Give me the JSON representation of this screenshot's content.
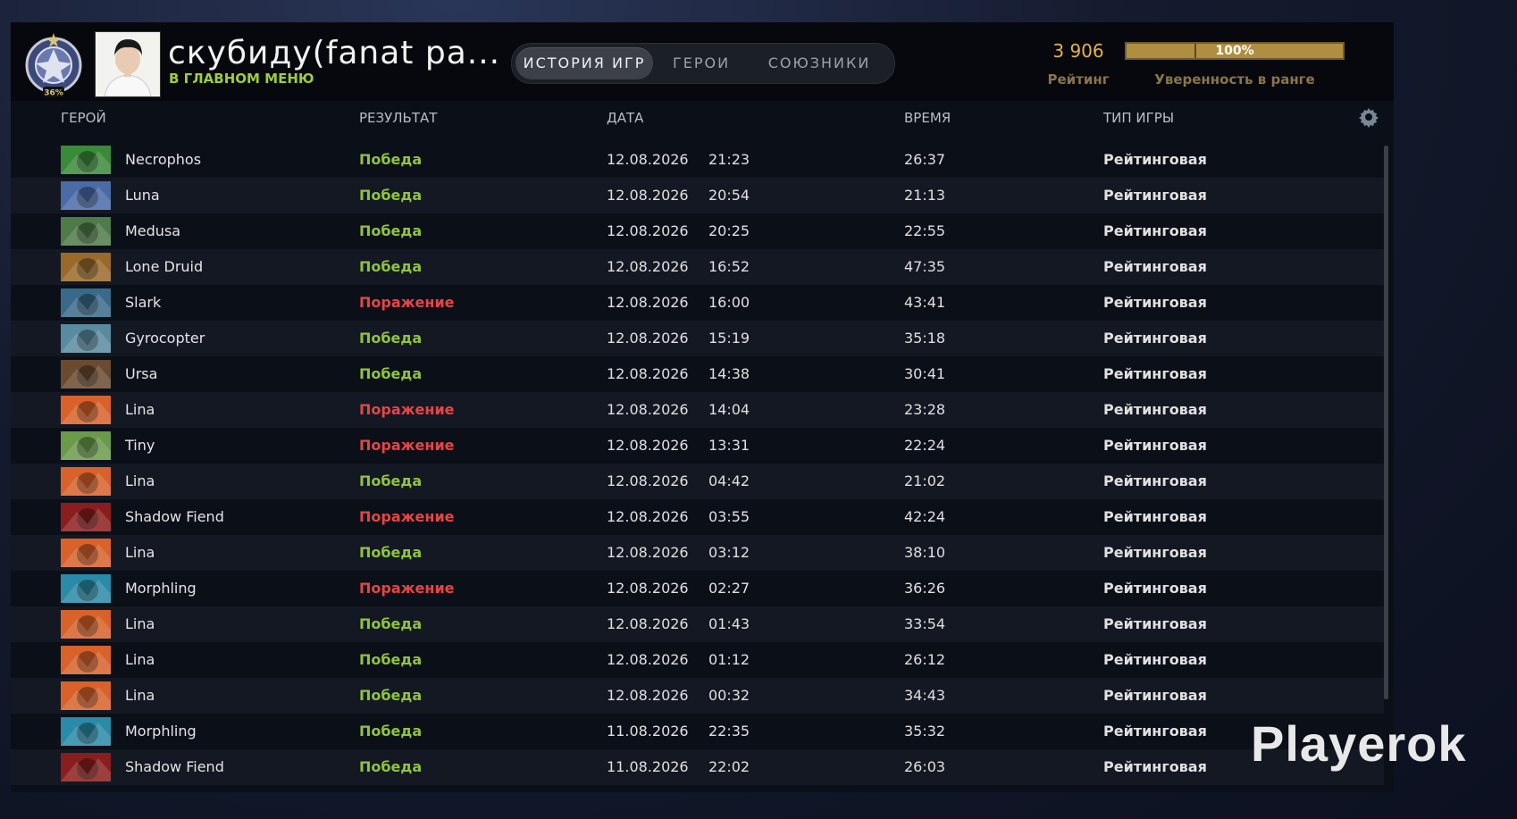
{
  "player": {
    "name": "скубиду(fanat ра...",
    "status": "В ГЛАВНОМ МЕНЮ",
    "rank_percent": "36%"
  },
  "tabs": [
    {
      "label": "ИСТОРИЯ ИГР",
      "active": true
    },
    {
      "label": "ГЕРОИ",
      "active": false
    },
    {
      "label": "СОЮЗНИКИ",
      "active": false
    }
  ],
  "rating": {
    "value": "3 906",
    "label": "Рейтинг"
  },
  "confidence": {
    "value": "100%",
    "label": "Уверенность в ранге",
    "fill": 1.0
  },
  "columns": {
    "hero": "ГЕРОЙ",
    "result": "РЕЗУЛЬТАТ",
    "date": "ДАТА",
    "duration": "ВРЕМЯ",
    "mode": "ТИП ИГРЫ"
  },
  "icons": {
    "settings": "gear-icon"
  },
  "colors": {
    "win": "#8fc43d",
    "loss": "#e64545",
    "accent": "#e6b24a"
  },
  "matches": [
    {
      "hero": "Necrophos",
      "result": "Победа",
      "win": true,
      "date": "12.08.2026",
      "time": "21:23",
      "duration": "26:37",
      "mode": "Рейтинговая",
      "hero_color": "#3a8a3a"
    },
    {
      "hero": "Luna",
      "result": "Победа",
      "win": true,
      "date": "12.08.2026",
      "time": "20:54",
      "duration": "21:13",
      "mode": "Рейтинговая",
      "hero_color": "#4a6aa8"
    },
    {
      "hero": "Medusa",
      "result": "Победа",
      "win": true,
      "date": "12.08.2026",
      "time": "20:25",
      "duration": "22:55",
      "mode": "Рейтинговая",
      "hero_color": "#4f7a4a"
    },
    {
      "hero": "Lone Druid",
      "result": "Победа",
      "win": true,
      "date": "12.08.2026",
      "time": "16:52",
      "duration": "47:35",
      "mode": "Рейтинговая",
      "hero_color": "#9a6a2a"
    },
    {
      "hero": "Slark",
      "result": "Поражение",
      "win": false,
      "date": "12.08.2026",
      "time": "16:00",
      "duration": "43:41",
      "mode": "Рейтинговая",
      "hero_color": "#3a6a8a"
    },
    {
      "hero": "Gyrocopter",
      "result": "Победа",
      "win": true,
      "date": "12.08.2026",
      "time": "15:19",
      "duration": "35:18",
      "mode": "Рейтинговая",
      "hero_color": "#5a8aa0"
    },
    {
      "hero": "Ursa",
      "result": "Победа",
      "win": true,
      "date": "12.08.2026",
      "time": "14:38",
      "duration": "30:41",
      "mode": "Рейтинговая",
      "hero_color": "#6a4a30"
    },
    {
      "hero": "Lina",
      "result": "Поражение",
      "win": false,
      "date": "12.08.2026",
      "time": "14:04",
      "duration": "23:28",
      "mode": "Рейтинговая",
      "hero_color": "#d8622a"
    },
    {
      "hero": "Tiny",
      "result": "Поражение",
      "win": false,
      "date": "12.08.2026",
      "time": "13:31",
      "duration": "22:24",
      "mode": "Рейтинговая",
      "hero_color": "#6a9a4a"
    },
    {
      "hero": "Lina",
      "result": "Победа",
      "win": true,
      "date": "12.08.2026",
      "time": "04:42",
      "duration": "21:02",
      "mode": "Рейтинговая",
      "hero_color": "#d8622a"
    },
    {
      "hero": "Shadow Fiend",
      "result": "Поражение",
      "win": false,
      "date": "12.08.2026",
      "time": "03:55",
      "duration": "42:24",
      "mode": "Рейтинговая",
      "hero_color": "#8a1e1e"
    },
    {
      "hero": "Lina",
      "result": "Победа",
      "win": true,
      "date": "12.08.2026",
      "time": "03:12",
      "duration": "38:10",
      "mode": "Рейтинговая",
      "hero_color": "#d8622a"
    },
    {
      "hero": "Morphling",
      "result": "Поражение",
      "win": false,
      "date": "12.08.2026",
      "time": "02:27",
      "duration": "36:26",
      "mode": "Рейтинговая",
      "hero_color": "#2a8aa8"
    },
    {
      "hero": "Lina",
      "result": "Победа",
      "win": true,
      "date": "12.08.2026",
      "time": "01:43",
      "duration": "33:54",
      "mode": "Рейтинговая",
      "hero_color": "#d8622a"
    },
    {
      "hero": "Lina",
      "result": "Победа",
      "win": true,
      "date": "12.08.2026",
      "time": "01:12",
      "duration": "26:12",
      "mode": "Рейтинговая",
      "hero_color": "#d8622a"
    },
    {
      "hero": "Lina",
      "result": "Победа",
      "win": true,
      "date": "12.08.2026",
      "time": "00:32",
      "duration": "34:43",
      "mode": "Рейтинговая",
      "hero_color": "#d8622a"
    },
    {
      "hero": "Morphling",
      "result": "Победа",
      "win": true,
      "date": "11.08.2026",
      "time": "22:35",
      "duration": "35:32",
      "mode": "Рейтинговая",
      "hero_color": "#2a8aa8"
    },
    {
      "hero": "Shadow Fiend",
      "result": "Победа",
      "win": true,
      "date": "11.08.2026",
      "time": "22:02",
      "duration": "26:03",
      "mode": "Рейтинговая",
      "hero_color": "#8a1e1e"
    }
  ],
  "watermark": "Playerok"
}
